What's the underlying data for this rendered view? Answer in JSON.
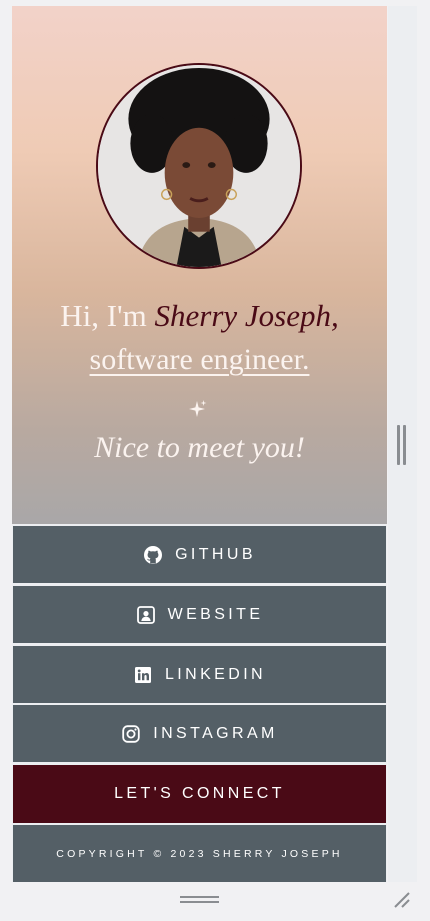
{
  "hero": {
    "greeting": "Hi, I'm ",
    "name": "Sherry Joseph,",
    "role": "software engineer.",
    "tagline": "Nice to meet you!"
  },
  "links": [
    {
      "label": "GITHUB",
      "icon": "github-icon"
    },
    {
      "label": "WEBSITE",
      "icon": "portrait-icon"
    },
    {
      "label": "LINKEDIN",
      "icon": "linkedin-icon"
    },
    {
      "label": "INSTAGRAM",
      "icon": "instagram-icon"
    }
  ],
  "connect": {
    "label": "LET'S CONNECT"
  },
  "footer": {
    "copyright": "COPYRIGHT © 2023 SHERRY JOSEPH"
  },
  "colors": {
    "accent": "#4a0a16",
    "button": "#545f66",
    "text_light": "#fbf3ef"
  }
}
